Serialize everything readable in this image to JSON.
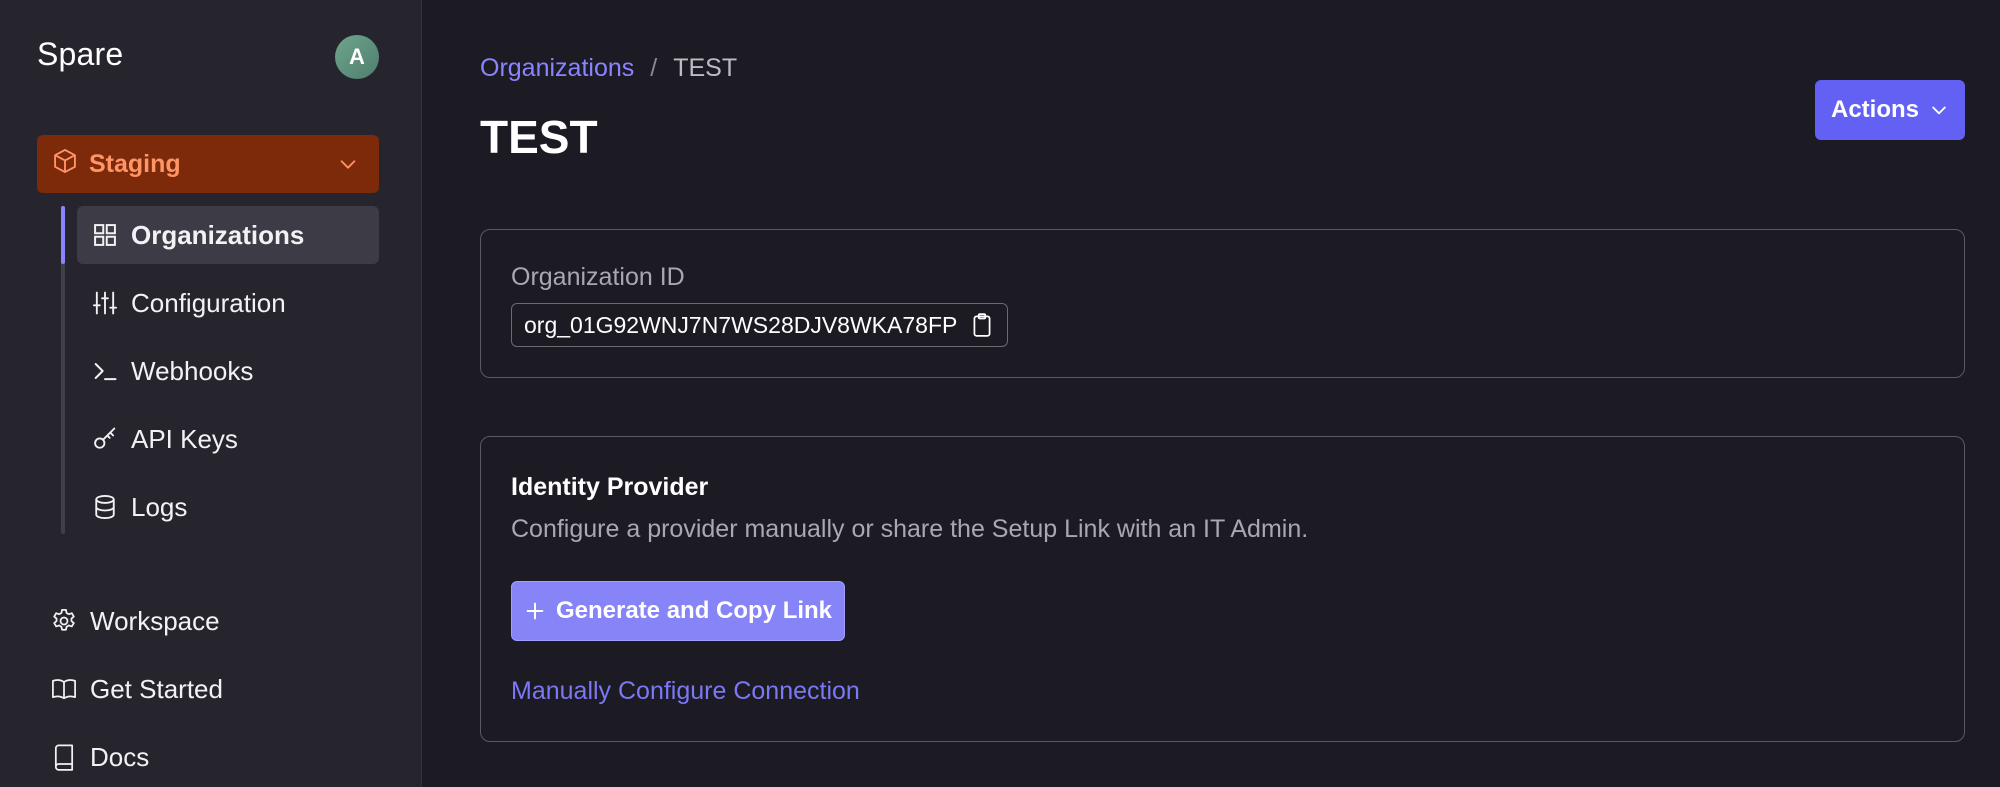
{
  "sidebar": {
    "brand": "Spare",
    "avatar_initial": "A",
    "environment": {
      "label": "Staging",
      "icon": "cube-icon"
    },
    "nav_items": [
      {
        "label": "Organizations",
        "icon": "grid-icon",
        "active": true
      },
      {
        "label": "Configuration",
        "icon": "sliders-icon",
        "active": false
      },
      {
        "label": "Webhooks",
        "icon": "terminal-icon",
        "active": false
      },
      {
        "label": "API Keys",
        "icon": "key-icon",
        "active": false
      },
      {
        "label": "Logs",
        "icon": "database-icon",
        "active": false
      }
    ],
    "workspace_items": [
      {
        "label": "Workspace",
        "icon": "gear-icon"
      },
      {
        "label": "Get Started",
        "icon": "open-book-icon"
      },
      {
        "label": "Docs",
        "icon": "book-icon"
      }
    ]
  },
  "header": {
    "breadcrumb": {
      "parent": "Organizations",
      "separator": "/",
      "current": "TEST"
    },
    "title": "TEST",
    "actions_label": "Actions"
  },
  "organization": {
    "id_label": "Organization ID",
    "id_value": "org_01G92WNJ7N7WS28DJV8WKA78FP"
  },
  "identity_provider": {
    "title": "Identity Provider",
    "description": "Configure a provider manually or share the Setup Link with an IT Admin.",
    "generate_label": "Generate and Copy Link",
    "manual_label": "Manually Configure Connection"
  },
  "colors": {
    "accent": "#6360f4",
    "link": "#8a84ff",
    "environment_bg": "#7d2a0b",
    "environment_text": "#ff9466"
  }
}
